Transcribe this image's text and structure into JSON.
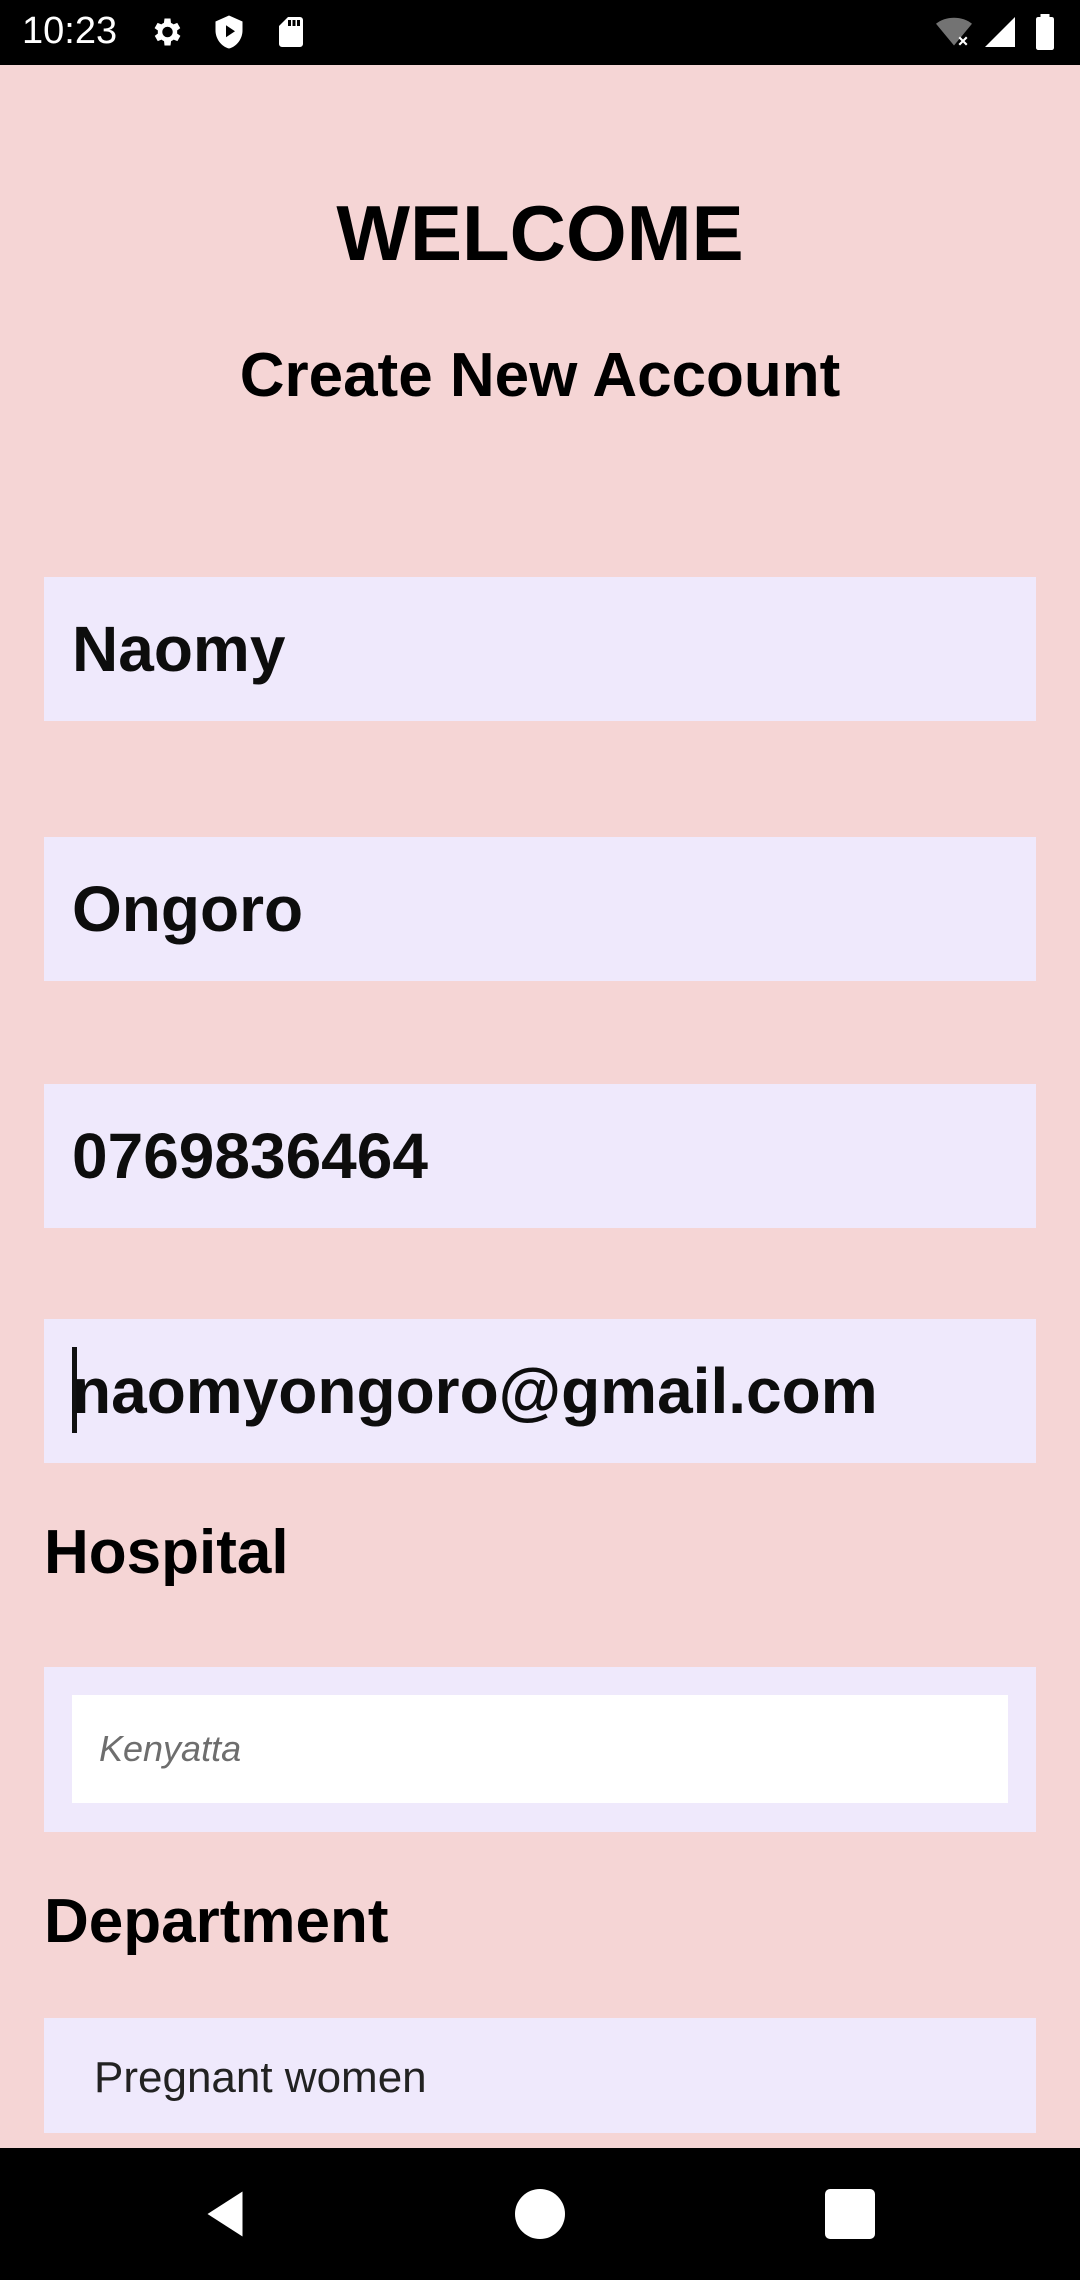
{
  "status_bar": {
    "time": "10:23",
    "left_icons": [
      "gear-icon",
      "shield-play-icon",
      "sd-card-icon"
    ],
    "right_icons": [
      "wifi-off-icon",
      "signal-icon",
      "battery-icon"
    ]
  },
  "header": {
    "title": "WELCOME",
    "subtitle": "Create New Account"
  },
  "form": {
    "first_name": "Naomy",
    "last_name": "Ongoro",
    "phone": "0769836464",
    "email": "naomyongoro@gmail.com",
    "hospital_label": "Hospital",
    "hospital_placeholder": "Kenyatta",
    "department_label": "Department",
    "department_value": "Pregnant women"
  },
  "nav_bar": {
    "buttons": [
      "back-icon",
      "home-icon",
      "recents-icon"
    ]
  },
  "colors": {
    "background": "#f5d5d5",
    "field_background": "#efe9fc",
    "bars": "#000000"
  }
}
